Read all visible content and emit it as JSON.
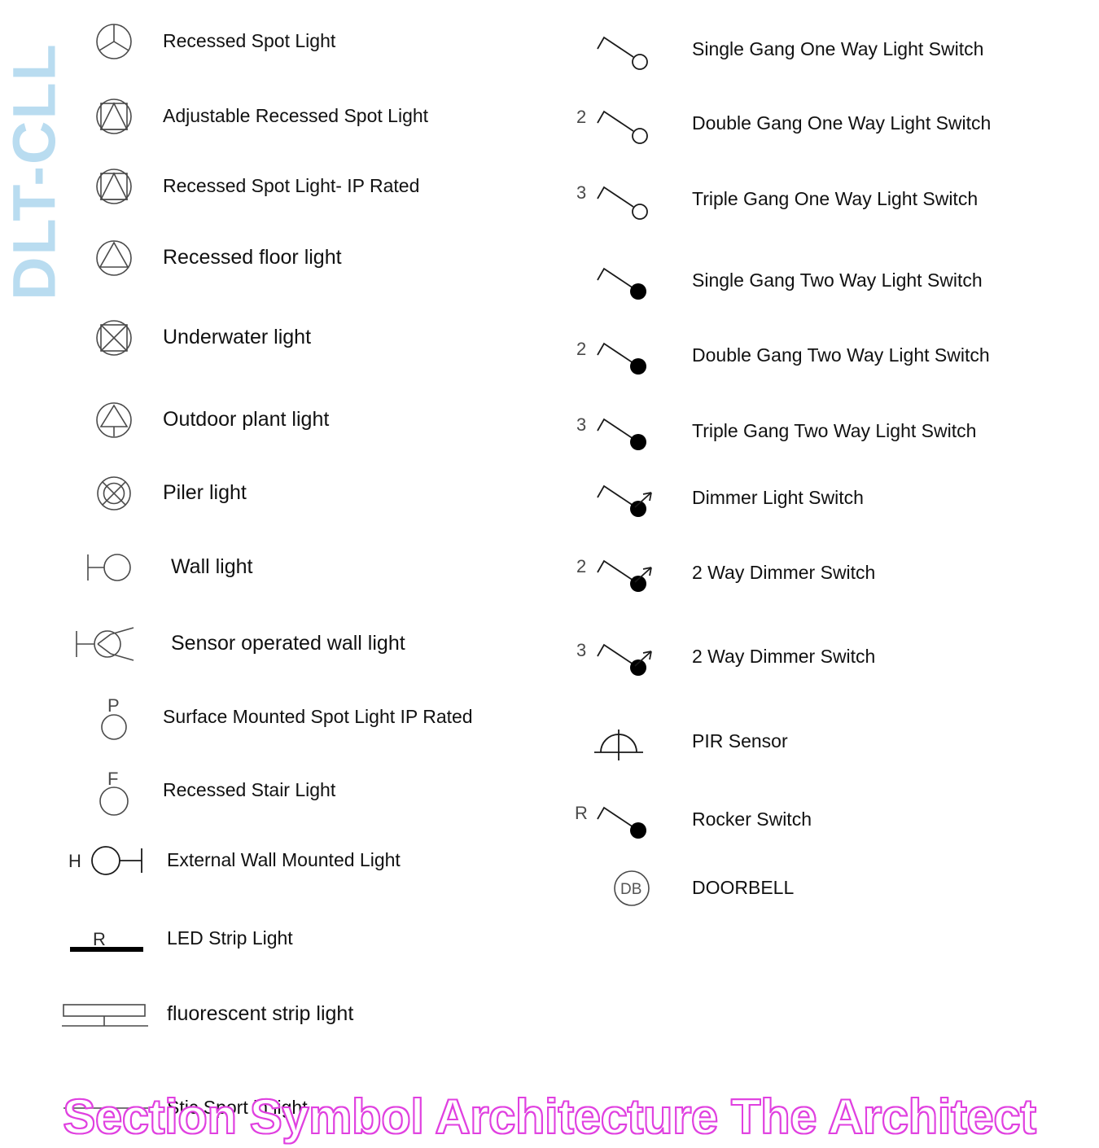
{
  "watermarks": {
    "side_text": "DLT-CLL",
    "side_color": "#b9dcf0",
    "bottom_text": "Section Symbol Architecture The Architect",
    "bottom_color": "#e040e0"
  },
  "obscured_caption": "Stic Sport in light",
  "left_column": {
    "items": [
      {
        "label": "Recessed Spot Light",
        "symbol": "circle-three-spoke-icon"
      },
      {
        "label": "Adjustable Recessed Spot Light",
        "symbol": "circle-square-triangle-icon"
      },
      {
        "label": "Recessed Spot Light- IP Rated",
        "symbol": "circle-square-triangle-icon"
      },
      {
        "label": "Recessed floor light",
        "symbol": "circle-triangle-icon"
      },
      {
        "label": "Underwater light",
        "symbol": "circle-square-cross-icon"
      },
      {
        "label": "Outdoor plant light",
        "symbol": "circle-triangle-stem-icon"
      },
      {
        "label": "Piler light",
        "symbol": "circle-cross-inner-circle-icon"
      },
      {
        "label": "Wall light",
        "symbol": "wall-bracket-circle-icon"
      },
      {
        "label": "Sensor operated wall light",
        "symbol": "wall-bracket-sensor-icon"
      },
      {
        "label": "Surface Mounted Spot Light IP Rated",
        "symbol": "letter-p-circle-icon",
        "letter": "P"
      },
      {
        "label": "Recessed Stair Light",
        "symbol": "letter-f-circle-icon",
        "letter": "F"
      },
      {
        "label": "External Wall Mounted Light",
        "symbol": "h-circle-bar-icon",
        "letter": "H"
      },
      {
        "label": "LED Strip Light",
        "symbol": "thick-bar-r-icon",
        "letter": "R"
      },
      {
        "label": "fluorescent strip light",
        "symbol": "fluorescent-strip-icon"
      }
    ]
  },
  "right_column": {
    "items": [
      {
        "label": "Single Gang One Way Light Switch",
        "symbol": "switch-open-icon",
        "gang": ""
      },
      {
        "label": "Double Gang One Way Light Switch",
        "symbol": "switch-open-icon",
        "gang": "2"
      },
      {
        "label": "Triple Gang One Way Light Switch",
        "symbol": "switch-open-icon",
        "gang": "3"
      },
      {
        "label": "Single Gang Two Way Light Switch",
        "symbol": "switch-filled-icon",
        "gang": ""
      },
      {
        "label": "Double Gang Two Way Light Switch",
        "symbol": "switch-filled-icon",
        "gang": "2"
      },
      {
        "label": "Triple Gang Two Way Light Switch",
        "symbol": "switch-filled-icon",
        "gang": "3"
      },
      {
        "label": "Dimmer Light Switch",
        "symbol": "switch-dimmer-icon",
        "gang": ""
      },
      {
        "label": "2 Way Dimmer Switch",
        "symbol": "switch-dimmer-icon",
        "gang": "2"
      },
      {
        "label": "2 Way Dimmer Switch",
        "symbol": "switch-dimmer-icon",
        "gang": "3"
      },
      {
        "label": "PIR Sensor",
        "symbol": "pir-dome-icon",
        "gang": ""
      },
      {
        "label": "Rocker Switch",
        "symbol": "switch-filled-icon",
        "gang": "R"
      },
      {
        "label": "DOORBELL",
        "symbol": "doorbell-db-icon",
        "gang": "",
        "inner": "DB"
      }
    ]
  }
}
